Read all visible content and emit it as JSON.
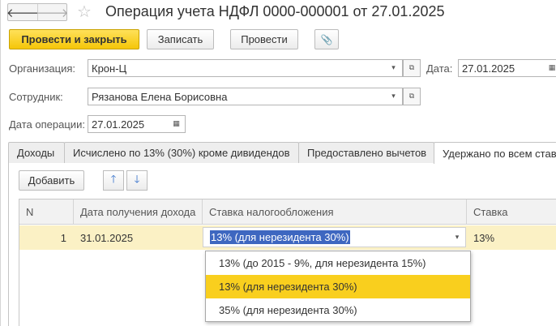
{
  "window": {
    "title": "Операция учета НДФЛ 0000-000001 от 27.01.2025",
    "nav_back": "🡐",
    "nav_forward": "🡒",
    "favorite_glyph": "☆"
  },
  "toolbar": {
    "post_and_close": "Провести и закрыть",
    "save": "Записать",
    "post": "Провести",
    "attach_glyph": "📎"
  },
  "form": {
    "organization_label": "Организация:",
    "organization_value": "Крон-Ц",
    "date_label": "Дата:",
    "date_value": "27.01.2025",
    "employee_label": "Сотрудник:",
    "employee_value": "Рязанова Елена Борисовна",
    "operation_date_label": "Дата операции:",
    "operation_date_value": "27.01.2025",
    "dropdown_glyph": "▾",
    "open_glyph": "⧉",
    "calendar_glyph": "▦"
  },
  "tabs": [
    {
      "label": "Доходы",
      "active": false
    },
    {
      "label": "Исчислено по 13% (30%) кроме дивидендов",
      "active": false
    },
    {
      "label": "Предоставлено вычетов",
      "active": false
    },
    {
      "label": "Удержано по всем ставкам",
      "active": true
    }
  ],
  "table_toolbar": {
    "add": "Добавить",
    "move_up_glyph": "🡑",
    "move_down_glyph": "🡓"
  },
  "table": {
    "columns": [
      "N",
      "Дата получения дохода",
      "Ставка налогообложения",
      "Ставка"
    ],
    "rows": [
      {
        "n": "1",
        "income_date": "31.01.2025",
        "tax_rate_type": "13% (для нерезидента 30%)",
        "rate": "13%"
      }
    ]
  },
  "dropdown": {
    "options": [
      {
        "label": "13% (до 2015 - 9%, для нерезидента 15%)",
        "selected": false
      },
      {
        "label": "13% (для нерезидента 30%)",
        "selected": true
      },
      {
        "label": "35% (для нерезидента 30%)",
        "selected": false
      }
    ]
  },
  "colors": {
    "accent_yellow": "#f5c608",
    "selected_row": "#fbf1c5",
    "selection_blue": "#3e67c0",
    "arrow_blue": "#2e6cc9"
  }
}
